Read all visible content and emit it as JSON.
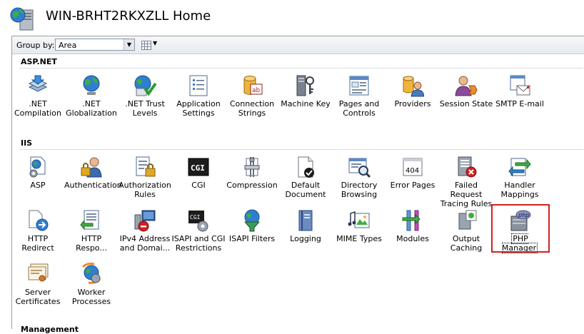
{
  "title": "WIN-BRHT2RKXZLL Home",
  "toolbar": {
    "group_by_label": "Group by:",
    "group_by_value": "Area"
  },
  "sections": {
    "aspnet": {
      "header": "ASP.NET"
    },
    "iis": {
      "header": "IIS"
    },
    "management": {
      "header": "Management"
    }
  },
  "tiles": {
    "net_compilation": ".NET\nCompilation",
    "net_globalization": ".NET\nGlobalization",
    "net_trust": ".NET Trust\nLevels",
    "app_settings": "Application\nSettings",
    "conn_strings": "Connection\nStrings",
    "machine_key": "Machine Key",
    "pages_controls": "Pages and\nControls",
    "providers": "Providers",
    "session_state": "Session State",
    "smtp": "SMTP E-mail",
    "asp": "ASP",
    "authentication": "Authentication",
    "authorization": "Authorization\nRules",
    "cgi": "CGI",
    "compression": "Compression",
    "default_doc": "Default\nDocument",
    "dir_browsing": "Directory\nBrowsing",
    "error_pages": "Error Pages",
    "failed_req": "Failed Request\nTracing Rules",
    "handler_mappings": "Handler\nMappings",
    "http_redirect": "HTTP Redirect",
    "http_response": "HTTP\nRespo...",
    "ipv4": "IPv4 Address\nand Domai...",
    "isapi_cgi": "ISAPI and CGI\nRestrictions",
    "isapi_filters": "ISAPI Filters",
    "logging": "Logging",
    "mime": "MIME Types",
    "modules": "Modules",
    "output_caching": "Output\nCaching",
    "php_manager": "PHP Manager",
    "server_certs": "Server\nCertificates",
    "worker_processes": "Worker\nProcesses"
  },
  "icons": {
    "cgi_text": "CGI",
    "cgi_small_text": "CGI",
    "error_text": "404",
    "php_text": "php",
    "ab_text": "ab"
  },
  "colors": {
    "accent_highlight": "#d32020",
    "globe_blue": "#2f7fd0",
    "globe_green": "#3fae3f"
  }
}
